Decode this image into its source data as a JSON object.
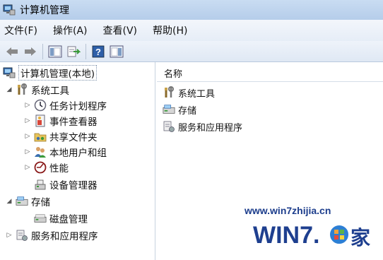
{
  "window": {
    "title": "计算机管理"
  },
  "menu": [
    {
      "label": "文件(F)"
    },
    {
      "label": "操作(A)"
    },
    {
      "label": "查看(V)"
    },
    {
      "label": "帮助(H)"
    }
  ],
  "toolbar": {
    "icons": [
      "back-icon",
      "forward-icon",
      "show-hide-tree-icon",
      "export-list-icon",
      "help-icon",
      "action-pane-icon"
    ]
  },
  "tree": {
    "root": {
      "label": "计算机管理(本地)"
    },
    "system_tools": {
      "label": "系统工具"
    },
    "task_scheduler": {
      "label": "任务计划程序"
    },
    "event_viewer": {
      "label": "事件查看器"
    },
    "shared_folders": {
      "label": "共享文件夹"
    },
    "local_users": {
      "label": "本地用户和组"
    },
    "performance": {
      "label": "性能"
    },
    "device_manager": {
      "label": "设备管理器"
    },
    "storage": {
      "label": "存储"
    },
    "disk_management": {
      "label": "磁盘管理"
    },
    "services_apps": {
      "label": "服务和应用程序"
    }
  },
  "list": {
    "column_header": "名称",
    "items": [
      {
        "label": "系统工具",
        "icon": "tools-icon"
      },
      {
        "label": "存储",
        "icon": "storage-icon"
      },
      {
        "label": "服务和应用程序",
        "icon": "services-icon"
      }
    ]
  },
  "watermark": {
    "url": "www.win7zhijia.cn",
    "logo_text": "WIN7.家"
  }
}
